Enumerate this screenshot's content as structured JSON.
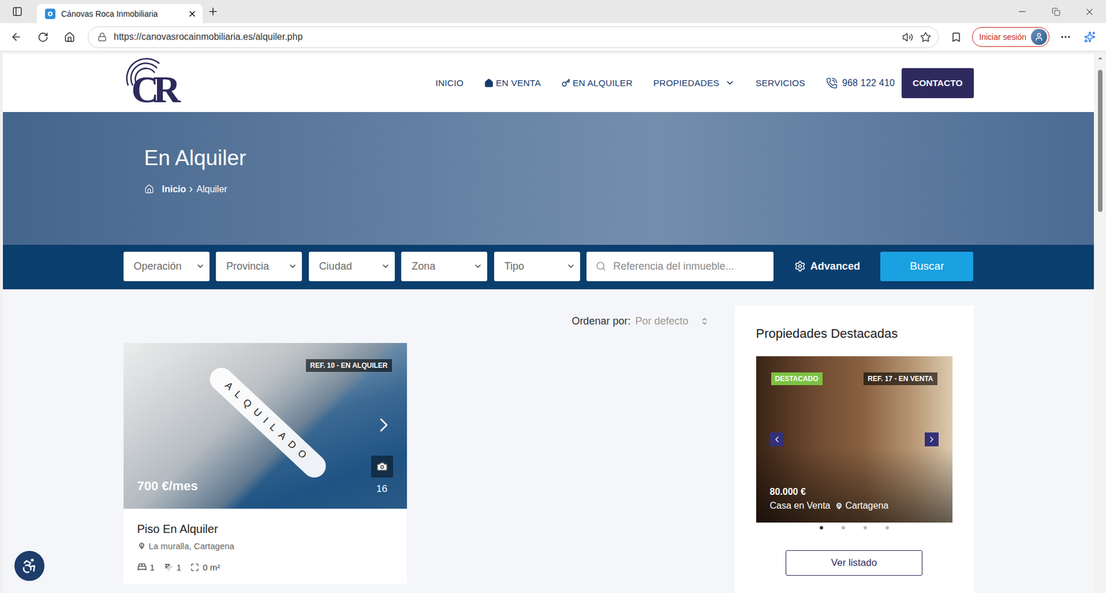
{
  "browser": {
    "tab": {
      "title": "Cánovas Roca Inmobiliaria",
      "selected": true
    },
    "address": {
      "url": "https://canovasrocainmobiliaria.es/alquiler.php"
    },
    "profile": {
      "label": "Iniciar sesión"
    }
  },
  "site": {
    "logo": "CR",
    "nav": [
      {
        "label": "INICIO",
        "kind": "plain"
      },
      {
        "label": "EN VENTA",
        "kind": "sale"
      },
      {
        "label": "EN ALQUILER",
        "kind": "rent"
      },
      {
        "label": "PROPIEDADES",
        "kind": "menu"
      },
      {
        "label": "SERVICIOS",
        "kind": "plain"
      }
    ],
    "phone": "968 122 410",
    "contact": "CONTACTO"
  },
  "hero": {
    "title": "En Alquiler",
    "breadcrumb": [
      {
        "label": "Inicio",
        "current": false
      },
      {
        "label": "Alquiler",
        "current": true
      }
    ]
  },
  "search": {
    "selects": [
      "Operación",
      "Provincia",
      "Ciudad",
      "Zona",
      "Tipo"
    ],
    "reference_placeholder": "Referencia del inmueble...",
    "advanced": "Advanced",
    "button": "Buscar"
  },
  "sort": {
    "label": "Ordenar por:",
    "value": "Por defecto"
  },
  "listings": [
    {
      "badge": "REF. 10 - EN ALQUILER",
      "stamp": "ALQUILADO",
      "price": "700 €/mes",
      "photos": "16",
      "title": "Piso En Alquiler",
      "location": "La muralla, Cartagena",
      "features": [
        "1",
        "1",
        "0 m²"
      ]
    }
  ],
  "featured": {
    "title": "Propiedades Destacadas",
    "items": [
      {
        "tag": "DESTACADO",
        "badge": "REF. 17 - EN VENTA",
        "price": "80.000 €",
        "type": "Casa en Venta",
        "city": "Cartagena"
      }
    ],
    "dots": [
      {
        "selected": true
      },
      {
        "selected": false
      },
      {
        "selected": false
      },
      {
        "selected": false
      }
    ],
    "button": "Ver listado"
  }
}
